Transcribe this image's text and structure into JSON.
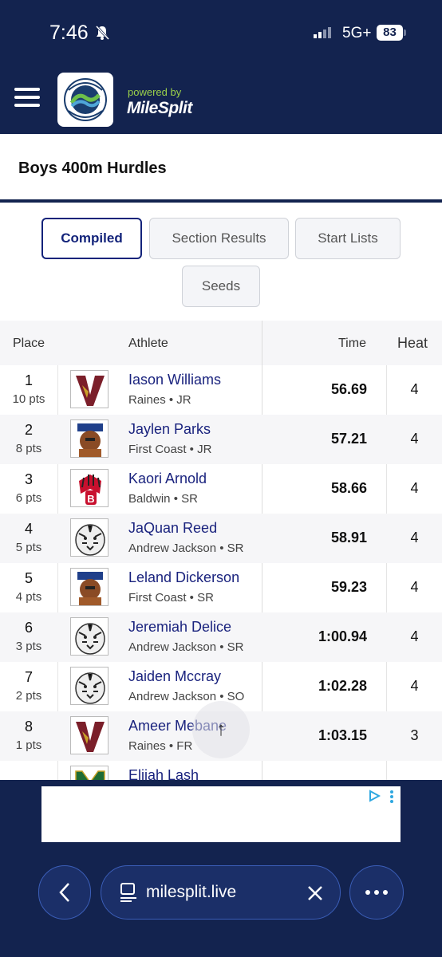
{
  "status_bar": {
    "time": "7:46",
    "network": "5G+",
    "battery": "83"
  },
  "header": {
    "powered_by": "powered by",
    "brand": "MileSplit",
    "club_logo_text": "JACKSONVILLE ATHLETIC CLUB"
  },
  "event": {
    "title": "Boys 400m Hurdles"
  },
  "tabs": [
    {
      "label": "Compiled",
      "active": true
    },
    {
      "label": "Section Results",
      "active": false
    },
    {
      "label": "Start Lists",
      "active": false
    },
    {
      "label": "Seeds",
      "active": false
    }
  ],
  "table": {
    "headers": {
      "place": "Place",
      "athlete": "Athlete",
      "time": "Time",
      "heat": "Heat"
    },
    "rows": [
      {
        "place": "1",
        "points": "10 pts",
        "name": "Iason Williams",
        "school": "Raines • JR",
        "time": "56.69",
        "heat": "4",
        "logo": "raines-v-logo"
      },
      {
        "place": "2",
        "points": "8 pts",
        "name": "Jaylen Parks",
        "school": "First Coast • JR",
        "time": "57.21",
        "heat": "4",
        "logo": "first-coast-logo"
      },
      {
        "place": "3",
        "points": "6 pts",
        "name": "Kaori Arnold",
        "school": "Baldwin • SR",
        "time": "58.66",
        "heat": "4",
        "logo": "baldwin-logo"
      },
      {
        "place": "4",
        "points": "5 pts",
        "name": "JaQuan Reed",
        "school": "Andrew Jackson • SR",
        "time": "58.91",
        "heat": "4",
        "logo": "andrew-jackson-tiger-logo"
      },
      {
        "place": "5",
        "points": "4 pts",
        "name": "Leland Dickerson",
        "school": "First Coast • SR",
        "time": "59.23",
        "heat": "4",
        "logo": "first-coast-logo"
      },
      {
        "place": "6",
        "points": "3 pts",
        "name": "Jeremiah Delice",
        "school": "Andrew Jackson • SR",
        "time": "1:00.94",
        "heat": "4",
        "logo": "andrew-jackson-tiger-logo"
      },
      {
        "place": "7",
        "points": "2 pts",
        "name": "Jaiden Mccray",
        "school": "Andrew Jackson • SO",
        "time": "1:02.28",
        "heat": "4",
        "logo": "andrew-jackson-tiger-logo"
      },
      {
        "place": "8",
        "points": "1 pts",
        "name": "Ameer Mebane",
        "school": "Raines • FR",
        "time": "1:03.15",
        "heat": "3",
        "logo": "raines-v-logo"
      },
      {
        "place": "",
        "points": "",
        "name": "Elijah Lash",
        "school": "",
        "time": "",
        "heat": "",
        "logo": "m-logo"
      }
    ]
  },
  "scroll_top_icon": "↑",
  "browser": {
    "url": "milesplit.live"
  },
  "colors": {
    "navy": "#13234f",
    "accent": "#1a237e",
    "green": "#9bd14a"
  }
}
